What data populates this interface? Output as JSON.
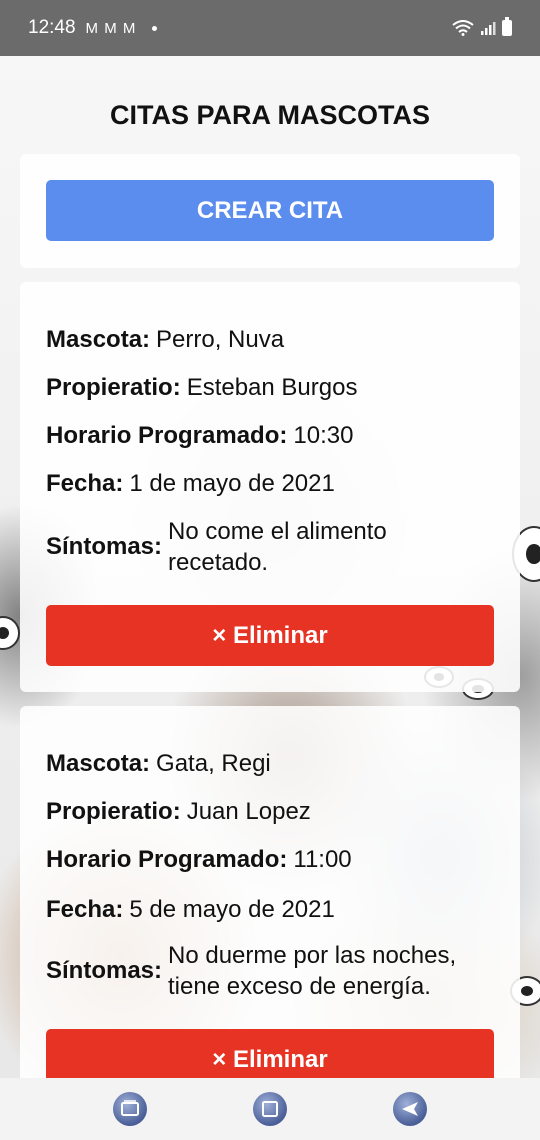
{
  "status_bar": {
    "time": "12:48",
    "notification_icons": "M M M",
    "dot": "•"
  },
  "app": {
    "title": "CITAS PARA MASCOTAS",
    "create_button_label": "CREAR CITA"
  },
  "labels": {
    "pet": "Mascota:",
    "owner": "Propieratio:",
    "time": "Horario Programado:",
    "date": "Fecha:",
    "symptoms": "Síntomas:"
  },
  "appointments": [
    {
      "pet": "Perro, Nuva",
      "owner": "Esteban Burgos",
      "time": "10:30",
      "date": "1 de mayo de 2021",
      "symptoms_line1": "No come el alimento",
      "symptoms_line2": "recetado.",
      "delete_label": "× Eliminar"
    },
    {
      "pet": "Gata, Regi",
      "owner": "Juan Lopez",
      "time": "11:00",
      "date": "5 de mayo de 2021",
      "symptoms_line1": "No duerme por las noches,",
      "symptoms_line2": "tiene exceso de energía.",
      "delete_label": "× Eliminar"
    }
  ],
  "colors": {
    "create_button": "#5b8def",
    "delete_button": "#e63323",
    "status_bar": "#6b6b6b"
  },
  "nav_bar": {
    "icons": [
      "recent-apps-icon",
      "home-icon",
      "back-icon"
    ]
  }
}
